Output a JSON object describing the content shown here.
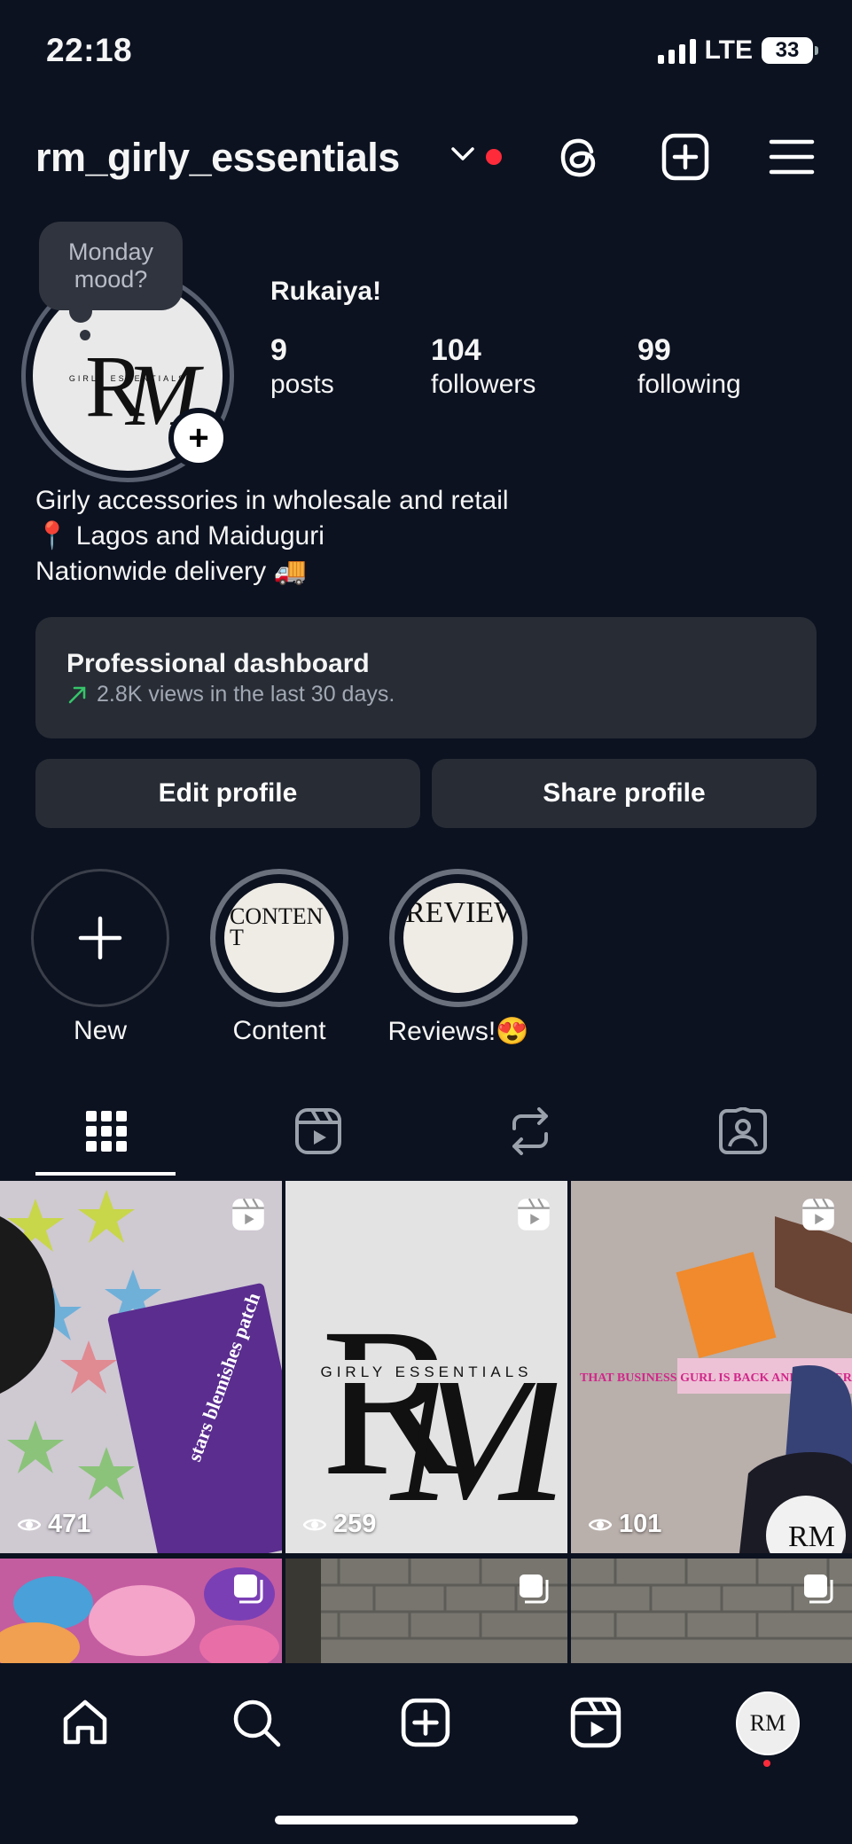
{
  "status": {
    "time": "22:18",
    "network": "LTE",
    "battery": "33"
  },
  "header": {
    "username": "rm_girly_essentials"
  },
  "profile": {
    "note": "Monday mood?",
    "display_name": "Rukaiya!",
    "stats": [
      {
        "value": "9",
        "label": "posts"
      },
      {
        "value": "104",
        "label": "followers"
      },
      {
        "value": "99",
        "label": "following"
      }
    ],
    "bio": [
      "Girly accessories in wholesale and retail",
      "📍 Lagos and Maiduguri",
      "Nationwide delivery 🚚"
    ]
  },
  "dashboard": {
    "title": "Professional dashboard",
    "subtitle": "2.8K views in the last 30 days."
  },
  "buttons": {
    "edit": "Edit profile",
    "share": "Share profile"
  },
  "highlights": [
    {
      "label": "New"
    },
    {
      "label": "Content",
      "cover_text": "CONTENT"
    },
    {
      "label": "Reviews!😍",
      "cover_text": "REVIEW"
    }
  ],
  "logo": {
    "text": "GIRLY ESSENTIALS",
    "mark": "RM"
  },
  "posts": [
    {
      "views": "471",
      "type": "reel",
      "caption": "stars blemishes patch"
    },
    {
      "views": "259",
      "type": "reel"
    },
    {
      "views": "101",
      "type": "reel",
      "caption": "THAT BUSINESS GURL IS BACK AND BETTER"
    },
    {
      "type": "carousel"
    },
    {
      "type": "carousel"
    },
    {
      "type": "carousel"
    }
  ],
  "colors": {
    "background": "#0c1220",
    "card": "#272c35",
    "accent_red": "#ff2b3a",
    "trend_green": "#36c46a"
  }
}
